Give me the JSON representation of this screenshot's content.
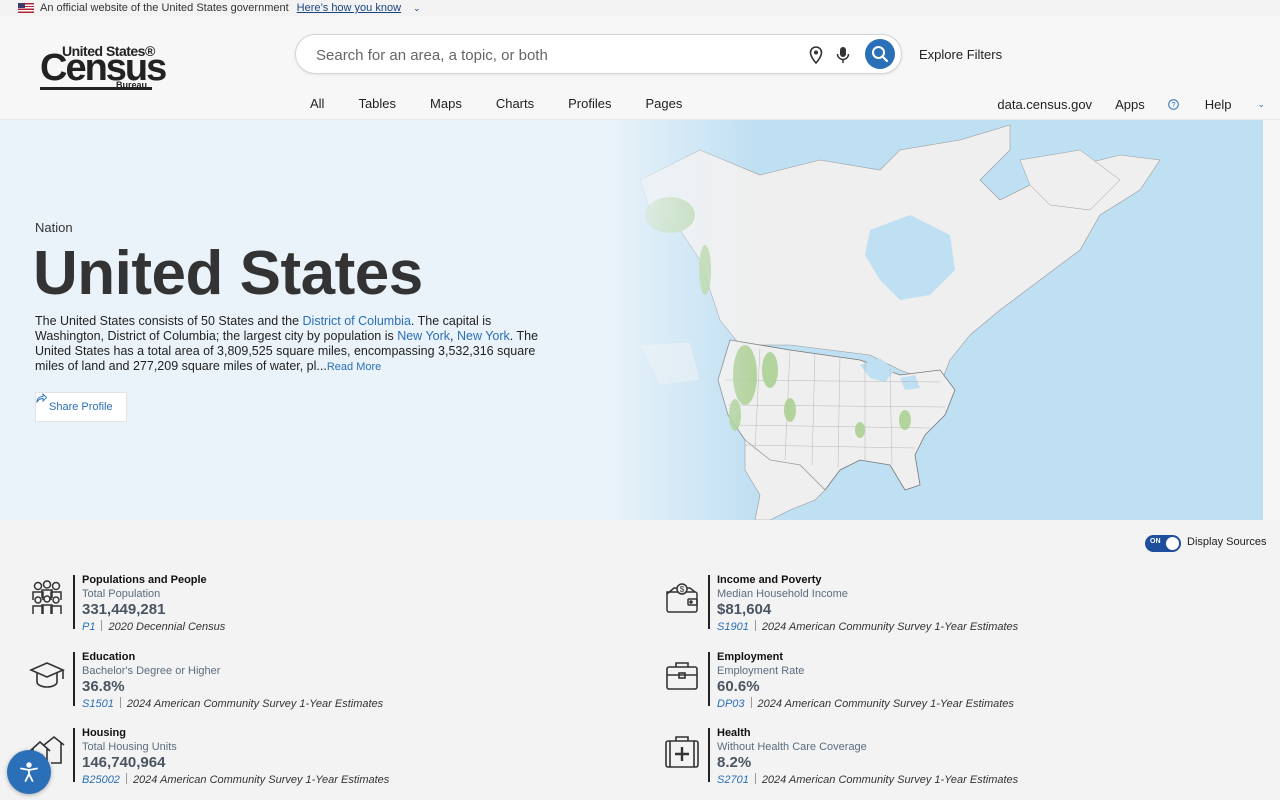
{
  "gov_banner": {
    "text": "An official website of the United States government",
    "link": "Here’s how you know"
  },
  "logo": {
    "line1": "United States®",
    "line2": "Census",
    "line3": "Bureau"
  },
  "search": {
    "placeholder": "Search for an area, a topic, or both"
  },
  "header": {
    "explore_filters": "Explore Filters",
    "tabs": [
      "All",
      "Tables",
      "Maps",
      "Charts",
      "Profiles",
      "Pages"
    ],
    "right_links": [
      "data.census.gov",
      "Apps",
      "Help"
    ]
  },
  "hero": {
    "level": "Nation",
    "title": "United States",
    "desc_1": "The United States consists of 50 States and the ",
    "link_dc": "District of Columbia",
    "desc_2": ". The capital is Washington, District of Columbia; the largest city by population is ",
    "link_ny1": "New York",
    "comma": ", ",
    "link_ny2": "New York",
    "desc_3": ". The United States has a total area of 3,809,525 square miles, encompassing 3,532,316 square miles of land and 277,209 square miles of water, pl...",
    "read_more": "Read More",
    "share": "Share Profile"
  },
  "sources_toggle": {
    "state": "ON",
    "label": "Display Sources"
  },
  "stats": [
    {
      "heading": "Populations and People",
      "label": "Total Population",
      "value": "331,449,281",
      "code": "P1",
      "source": "2020 Decennial Census",
      "icon": "people-icon"
    },
    {
      "heading": "Income and Poverty",
      "label": "Median Household Income",
      "value": "$81,604",
      "code": "S1901",
      "source": "2024 American Community Survey 1-Year Estimates",
      "icon": "wallet-icon"
    },
    {
      "heading": "Education",
      "label": "Bachelor's Degree or Higher",
      "value": "36.8%",
      "code": "S1501",
      "source": "2024 American Community Survey 1-Year Estimates",
      "icon": "graduation-cap-icon"
    },
    {
      "heading": "Employment",
      "label": "Employment Rate",
      "value": "60.6%",
      "code": "DP03",
      "source": "2024 American Community Survey 1-Year Estimates",
      "icon": "briefcase-icon"
    },
    {
      "heading": "Housing",
      "label": "Total Housing Units",
      "value": "146,740,964",
      "code": "B25002",
      "source": "2024 American Community Survey 1-Year Estimates",
      "icon": "houses-icon"
    },
    {
      "heading": "Health",
      "label": "Without Health Care Coverage",
      "value": "8.2%",
      "code": "S2701",
      "source": "2024 American Community Survey 1-Year Estimates",
      "icon": "medical-kit-icon"
    }
  ],
  "colors": {
    "accent": "#2a6fb8",
    "toggle": "#1f4e9c",
    "water": "#bfdff2",
    "land": "#efefef",
    "green": "#a9cf8f"
  }
}
